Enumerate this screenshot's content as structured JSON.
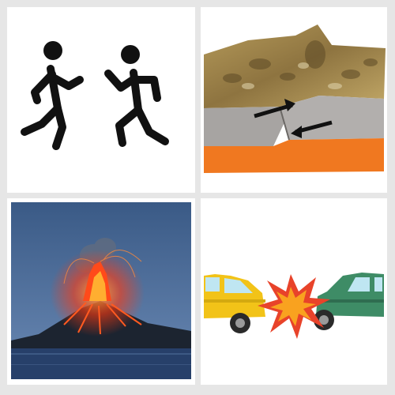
{
  "tiles": [
    {
      "name": "running-people"
    },
    {
      "name": "tectonic-fault"
    },
    {
      "name": "volcano-eruption"
    },
    {
      "name": "car-collision"
    }
  ],
  "colors": {
    "background": "#e6e6e6",
    "crust_orange": "#f07820",
    "lava": "#ff3a10",
    "car_yellow": "#f2c318",
    "car_green": "#3e8c66",
    "sea": "#27406a"
  }
}
